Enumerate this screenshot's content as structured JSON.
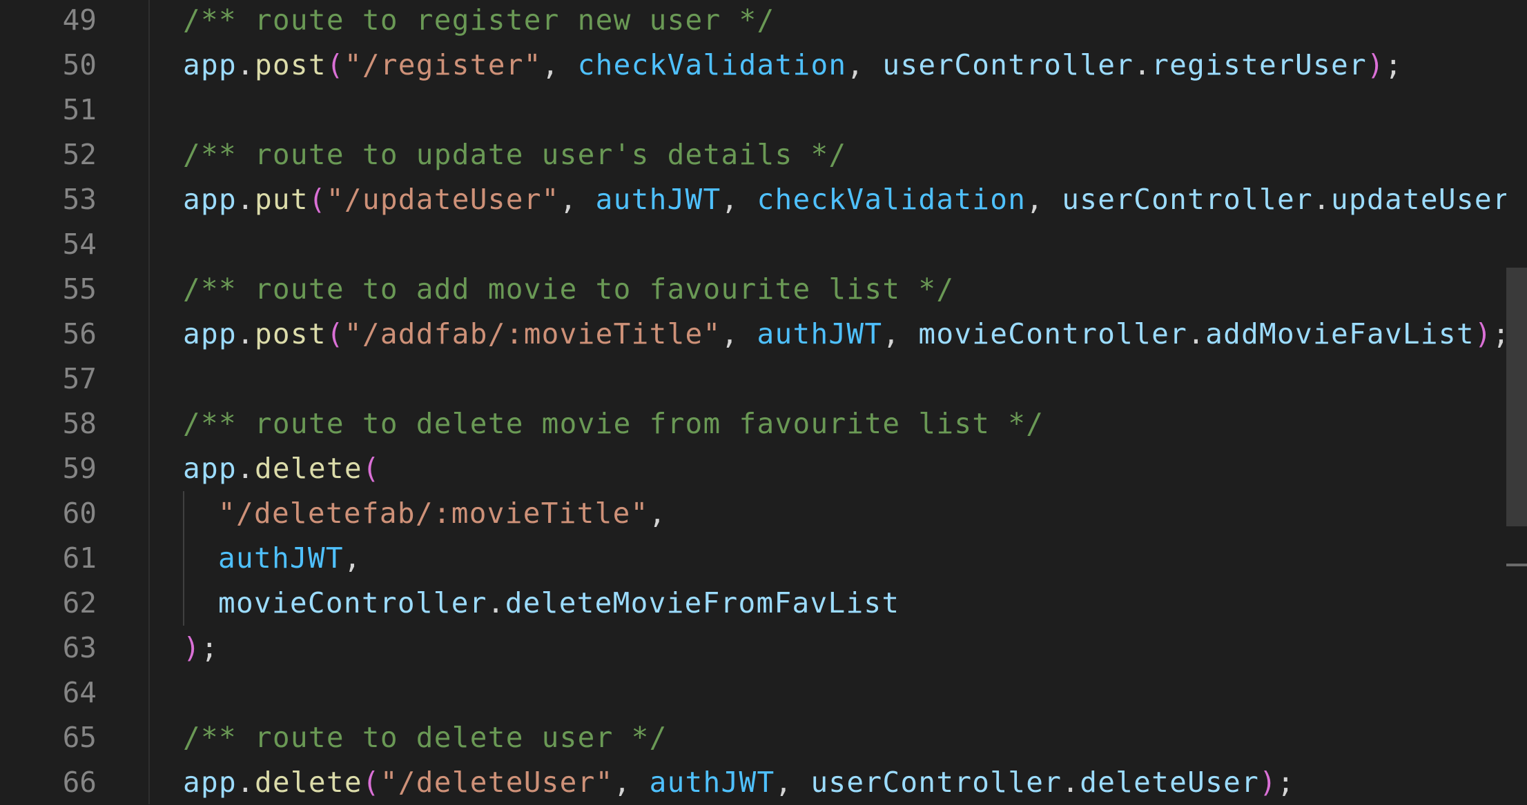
{
  "editor": {
    "lines": [
      {
        "number": "49",
        "tokens": [
          {
            "text": "/** route to register new user */",
            "kind": "comment"
          }
        ]
      },
      {
        "number": "50",
        "tokens": [
          {
            "text": "app",
            "kind": "var"
          },
          {
            "text": ".",
            "kind": "default"
          },
          {
            "text": "post",
            "kind": "method"
          },
          {
            "text": "(",
            "kind": "paren"
          },
          {
            "text": "\"/register\"",
            "kind": "string"
          },
          {
            "text": ", ",
            "kind": "default"
          },
          {
            "text": "checkValidation",
            "kind": "func"
          },
          {
            "text": ", ",
            "kind": "default"
          },
          {
            "text": "userController",
            "kind": "var"
          },
          {
            "text": ".",
            "kind": "default"
          },
          {
            "text": "registerUser",
            "kind": "var"
          },
          {
            "text": ")",
            "kind": "paren"
          },
          {
            "text": ";",
            "kind": "default"
          }
        ]
      },
      {
        "number": "51",
        "tokens": []
      },
      {
        "number": "52",
        "tokens": [
          {
            "text": "/** route to update user's details */",
            "kind": "comment"
          }
        ]
      },
      {
        "number": "53",
        "tokens": [
          {
            "text": "app",
            "kind": "var"
          },
          {
            "text": ".",
            "kind": "default"
          },
          {
            "text": "put",
            "kind": "method"
          },
          {
            "text": "(",
            "kind": "paren"
          },
          {
            "text": "\"/updateUser\"",
            "kind": "string"
          },
          {
            "text": ", ",
            "kind": "default"
          },
          {
            "text": "authJWT",
            "kind": "func"
          },
          {
            "text": ", ",
            "kind": "default"
          },
          {
            "text": "checkValidation",
            "kind": "func"
          },
          {
            "text": ", ",
            "kind": "default"
          },
          {
            "text": "userController",
            "kind": "var"
          },
          {
            "text": ".",
            "kind": "default"
          },
          {
            "text": "updateUser",
            "kind": "var"
          },
          {
            "text": ")",
            "kind": "paren"
          },
          {
            "text": ";",
            "kind": "default"
          }
        ]
      },
      {
        "number": "54",
        "tokens": []
      },
      {
        "number": "55",
        "tokens": [
          {
            "text": "/** route to add movie to favourite list */",
            "kind": "comment"
          }
        ]
      },
      {
        "number": "56",
        "tokens": [
          {
            "text": "app",
            "kind": "var"
          },
          {
            "text": ".",
            "kind": "default"
          },
          {
            "text": "post",
            "kind": "method"
          },
          {
            "text": "(",
            "kind": "paren"
          },
          {
            "text": "\"/addfab/:movieTitle\"",
            "kind": "string"
          },
          {
            "text": ", ",
            "kind": "default"
          },
          {
            "text": "authJWT",
            "kind": "func"
          },
          {
            "text": ", ",
            "kind": "default"
          },
          {
            "text": "movieController",
            "kind": "var"
          },
          {
            "text": ".",
            "kind": "default"
          },
          {
            "text": "addMovieFavList",
            "kind": "var"
          },
          {
            "text": ")",
            "kind": "paren"
          },
          {
            "text": ";",
            "kind": "default"
          }
        ]
      },
      {
        "number": "57",
        "tokens": []
      },
      {
        "number": "58",
        "tokens": [
          {
            "text": "/** route to delete movie from favourite list */",
            "kind": "comment"
          }
        ]
      },
      {
        "number": "59",
        "tokens": [
          {
            "text": "app",
            "kind": "var"
          },
          {
            "text": ".",
            "kind": "default"
          },
          {
            "text": "delete",
            "kind": "method"
          },
          {
            "text": "(",
            "kind": "paren"
          }
        ]
      },
      {
        "number": "60",
        "indent": true,
        "tokens": [
          {
            "text": "\"/deletefab/:movieTitle\"",
            "kind": "string"
          },
          {
            "text": ",",
            "kind": "default"
          }
        ]
      },
      {
        "number": "61",
        "indent": true,
        "tokens": [
          {
            "text": "authJWT",
            "kind": "func"
          },
          {
            "text": ",",
            "kind": "default"
          }
        ]
      },
      {
        "number": "62",
        "indent": true,
        "tokens": [
          {
            "text": "movieController",
            "kind": "var"
          },
          {
            "text": ".",
            "kind": "default"
          },
          {
            "text": "deleteMovieFromFavList",
            "kind": "var"
          }
        ]
      },
      {
        "number": "63",
        "tokens": [
          {
            "text": ")",
            "kind": "paren"
          },
          {
            "text": ";",
            "kind": "default"
          }
        ]
      },
      {
        "number": "64",
        "tokens": []
      },
      {
        "number": "65",
        "tokens": [
          {
            "text": "/** route to delete user */",
            "kind": "comment"
          }
        ]
      },
      {
        "number": "66",
        "tokens": [
          {
            "text": "app",
            "kind": "var"
          },
          {
            "text": ".",
            "kind": "default"
          },
          {
            "text": "delete",
            "kind": "method"
          },
          {
            "text": "(",
            "kind": "paren"
          },
          {
            "text": "\"/deleteUser\"",
            "kind": "string"
          },
          {
            "text": ", ",
            "kind": "default"
          },
          {
            "text": "authJWT",
            "kind": "func"
          },
          {
            "text": ", ",
            "kind": "default"
          },
          {
            "text": "userController",
            "kind": "var"
          },
          {
            "text": ".",
            "kind": "default"
          },
          {
            "text": "deleteUser",
            "kind": "var"
          },
          {
            "text": ")",
            "kind": "paren"
          },
          {
            "text": ";",
            "kind": "default"
          }
        ]
      }
    ]
  },
  "theme": {
    "background": "#1e1e1e",
    "line_number": "#858585",
    "comment": "#6a9955",
    "string": "#ce9178",
    "method": "#dcdcaa",
    "variable": "#9cdcfe",
    "function_ref": "#4fc1ff",
    "bracket": "#da70d6",
    "punctuation": "#d4d4d4"
  }
}
